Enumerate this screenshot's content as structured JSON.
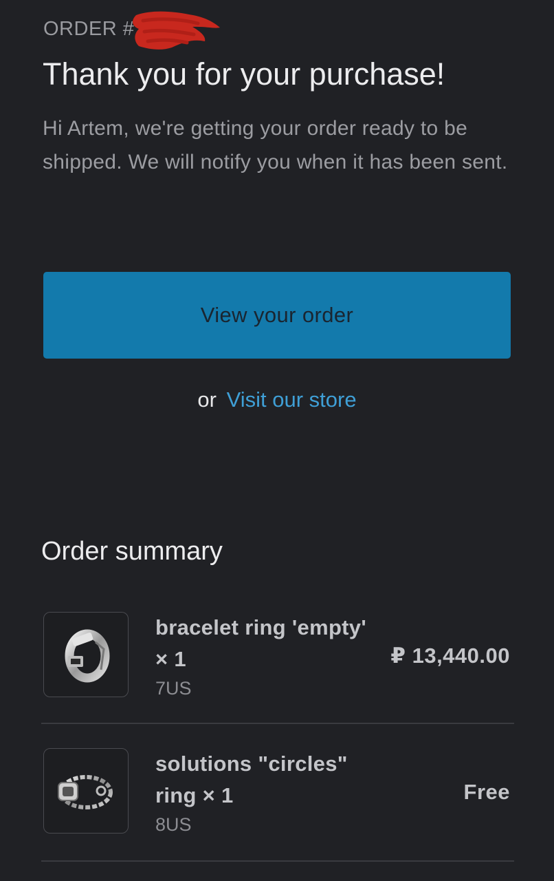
{
  "header": {
    "order_label": "ORDER #",
    "order_number": "",
    "title": "Thank you for your purchase!",
    "intro": "Hi Artem, we're getting your order ready to be shipped. We will notify you when it has been sent."
  },
  "actions": {
    "view_order_label": "View your order",
    "or_text": "or",
    "visit_store_label": "Visit our store"
  },
  "summary": {
    "heading": "Order summary",
    "items": [
      {
        "name": "bracelet ring 'empty' × 1",
        "variant": "7US",
        "price": "₽ 13,440.00",
        "thumbnail_icon": "ring-product-image"
      },
      {
        "name": "solutions \"circles\" ring × 1",
        "variant": "8US",
        "price": "Free",
        "thumbnail_icon": "chain-ring-product-image"
      }
    ]
  },
  "colors": {
    "background": "#202125",
    "button": "#137aac",
    "link": "#3f9fd6",
    "redaction": "#c8281e"
  }
}
